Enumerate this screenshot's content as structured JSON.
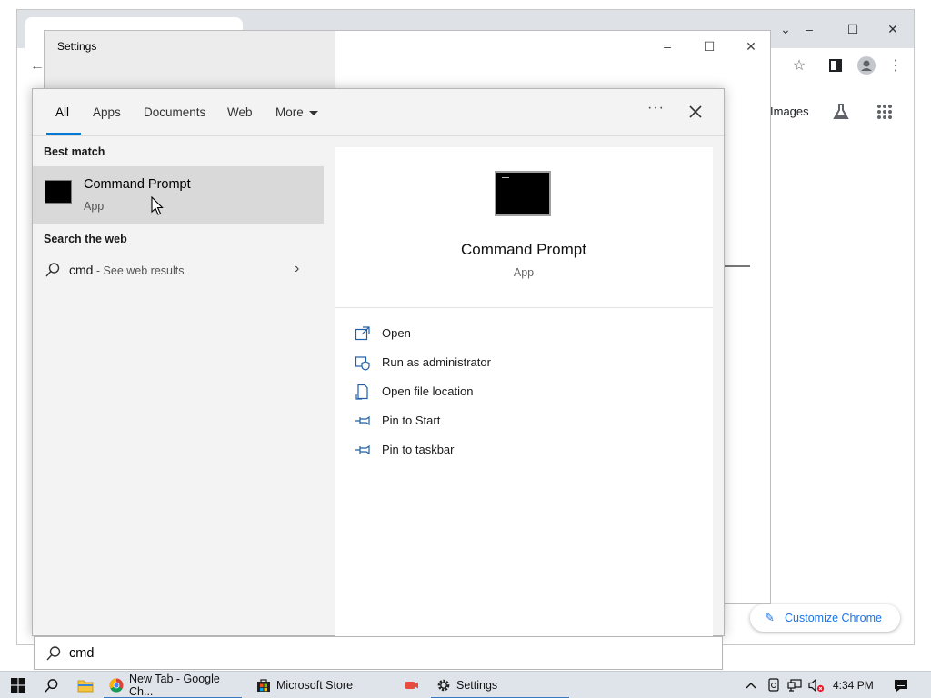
{
  "search": {
    "tabs": [
      {
        "label": "All"
      },
      {
        "label": "Apps"
      },
      {
        "label": "Documents"
      },
      {
        "label": "Web"
      },
      {
        "label": "More"
      }
    ],
    "best_match_heading": "Best match",
    "best_match": {
      "name": "Command Prompt",
      "type": "App"
    },
    "web_heading": "Search the web",
    "web_result": {
      "query": "cmd",
      "suffix": " - See web results"
    },
    "preview": {
      "name": "Command Prompt",
      "type": "App",
      "actions": [
        {
          "label": "Open",
          "icon": "open-icon"
        },
        {
          "label": "Run as administrator",
          "icon": "shield-icon"
        },
        {
          "label": "Open file location",
          "icon": "file-location-icon"
        },
        {
          "label": "Pin to Start",
          "icon": "pin-icon"
        },
        {
          "label": "Pin to taskbar",
          "icon": "pin-icon"
        }
      ]
    },
    "box_value": "cmd"
  },
  "settings_window": {
    "title": "Settings"
  },
  "chrome": {
    "images_link": "Images",
    "customize_label": "Customize Chrome"
  },
  "taskbar": {
    "items": [
      {
        "label": "New Tab - Google Ch..."
      },
      {
        "label": "Microsoft Store"
      },
      {
        "label": "Settings"
      }
    ],
    "clock": "4:34 PM"
  },
  "colors": {
    "accent": "#0078d4",
    "taskbar_bg": "#dfe3ea",
    "flyout_bg": "#f3f3f3",
    "selected_bg": "#d9d9d9"
  }
}
